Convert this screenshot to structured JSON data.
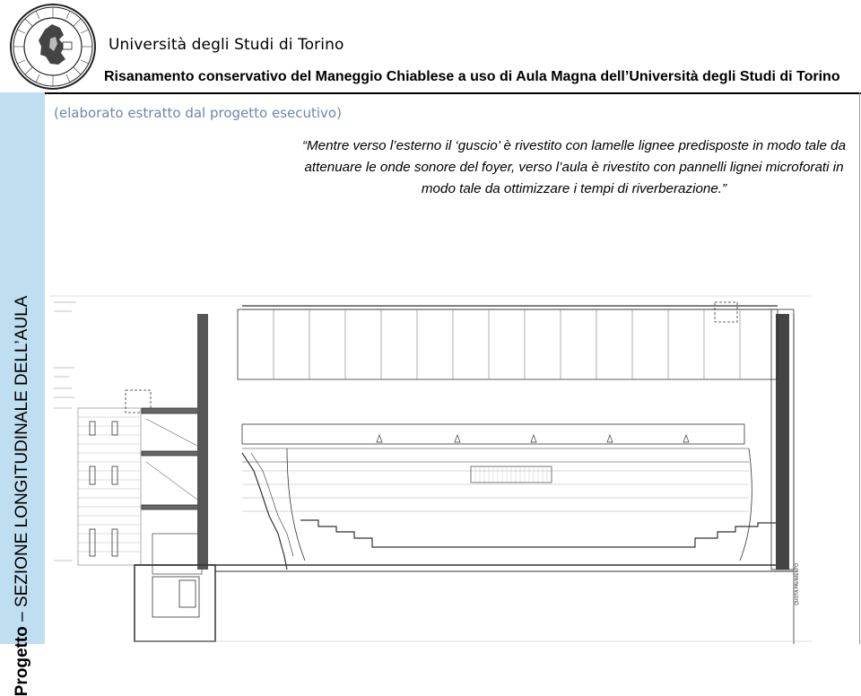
{
  "header": {
    "university": "Università degli Studi di Torino",
    "title": "Risanamento conservativo del Maneggio Chiablese a uso di Aula Magna dell’Università degli Studi di Torino"
  },
  "side": {
    "prefix": "Progetto",
    "dash": "–",
    "title": "SEZIONE LONGITUDINALE DELL’AULA"
  },
  "subtitle": "(elaborato estratto dal progetto esecutivo)",
  "caption": "“Mentre verso l’esterno il ‘guscio’ è rivestito con lamelle lignee predisposte in modo tale da attenuare le onde sonore del foyer, verso l’aula è rivestito con pannelli lignei microforati in modo tale da ottimizzare i tempi di riverberazione.”",
  "logo": {
    "icon": "university-seal",
    "text": "SIGIL UNIVERSITATIS TAURINENSIS"
  },
  "colors": {
    "band": "#bfdff0",
    "subtitle": "#6f86a8"
  },
  "drawing": {
    "icon": "longitudinal-section-drawing",
    "label": "QUOTA PAVIMENTO"
  }
}
